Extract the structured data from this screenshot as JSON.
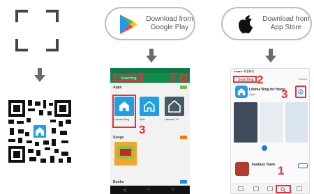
{
  "google_play": {
    "label": "Download from Google Play"
  },
  "app_store": {
    "label": "Download from App Store"
  },
  "android": {
    "search_text": "Searching",
    "section_apps": "Apps",
    "section_songs": "Songs",
    "section_books": "Books",
    "more_label": "MORE",
    "apps": [
      {
        "name": "Lifeme Bing"
      },
      {
        "name": "Skin"
      },
      {
        "name": "Lifemes TV"
      }
    ]
  },
  "iphone": {
    "status": "●●●●● 中国移动",
    "search_text": "Searching",
    "cancel": "Cancel",
    "app_title": "Lifeme Bing for Home",
    "app_sub": "Apps",
    "app2_title": "Fantasy Town"
  },
  "steps": {
    "one": "1",
    "two": "2",
    "three": "3"
  },
  "colors": {
    "highlight": "#e53238",
    "play_green": "#108a4d",
    "app_blue": "#1fa0e3",
    "arrow_gray": "#6b6b6b"
  }
}
